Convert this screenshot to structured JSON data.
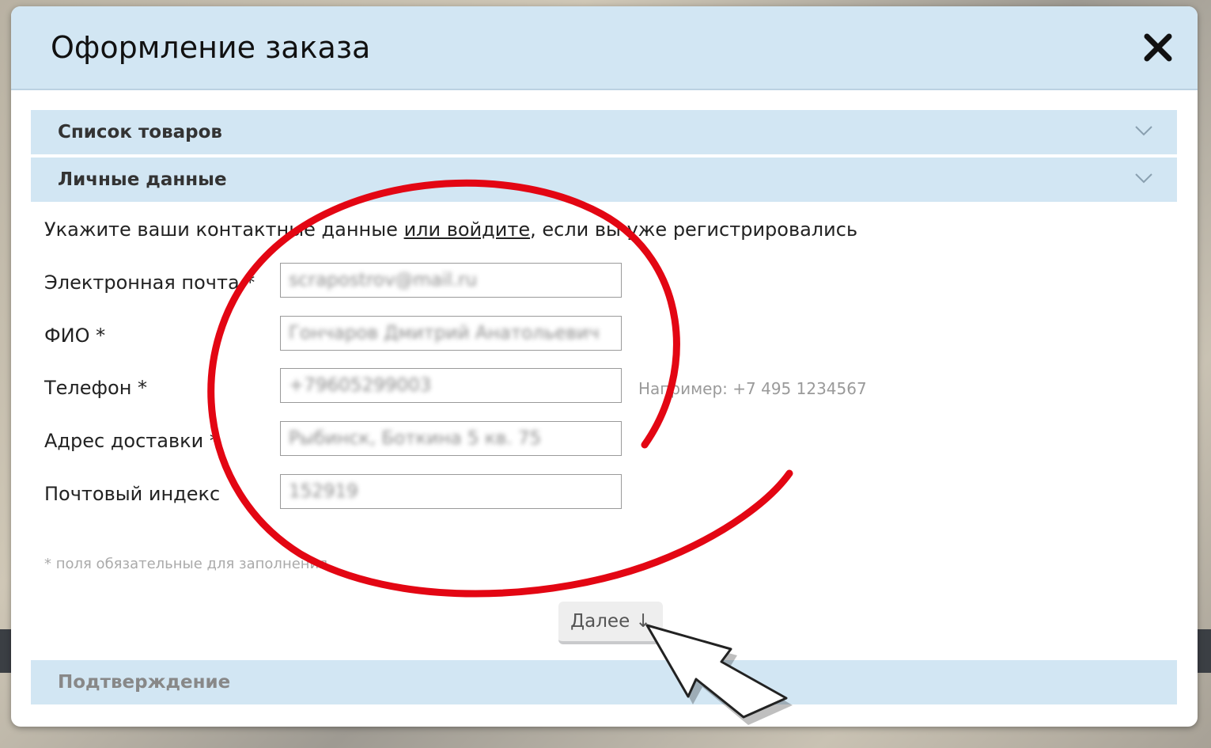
{
  "modal": {
    "title": "Оформление заказа",
    "close_label": "close"
  },
  "sections": {
    "products": "Список товаров",
    "personal": "Личные данные",
    "confirmation": "Подтверждение"
  },
  "intro": {
    "before": "Укажите ваши контактные данные ",
    "link": "или войдите",
    "after": ", если вы уже регистрировались"
  },
  "fields": {
    "email": {
      "label": "Электронная почта *",
      "value": "scrapostrov@mail.ru"
    },
    "name": {
      "label": "ФИО *",
      "value": "Гончаров Дмитрий Анатольевич"
    },
    "phone": {
      "label": "Телефон *",
      "value": "+79605299003",
      "hint": "Например: +7 495 1234567"
    },
    "address": {
      "label": "Адрес доставки *",
      "value": "Рыбинск, Боткина 5 кв. 75"
    },
    "zip": {
      "label": "Почтовый индекс",
      "value": "152919"
    }
  },
  "required_note": "* поля обязательные для заполнения",
  "next_button": "Далее ↓",
  "colors": {
    "header_bg": "#d2e6f3",
    "annotation": "#e30613"
  },
  "icons": {
    "close": "close-icon",
    "chevron": "chevron-down-icon",
    "pointer": "arrow-pointer-icon"
  }
}
